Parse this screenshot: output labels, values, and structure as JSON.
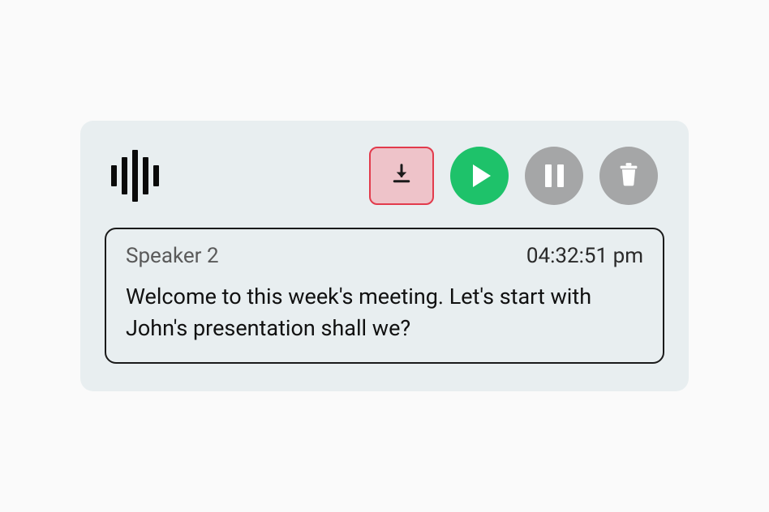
{
  "transcript": {
    "speaker": "Speaker 2",
    "timestamp": "04:32:51 pm",
    "text": "Welcome to this week's meeting. Let's start with John's presentation shall we?"
  },
  "colors": {
    "card_bg": "#e8eef0",
    "download_border": "#e23b4c",
    "download_bg": "#eec3c9",
    "play_bg": "#1ec26a",
    "grey_bg": "#a5a6a7"
  }
}
